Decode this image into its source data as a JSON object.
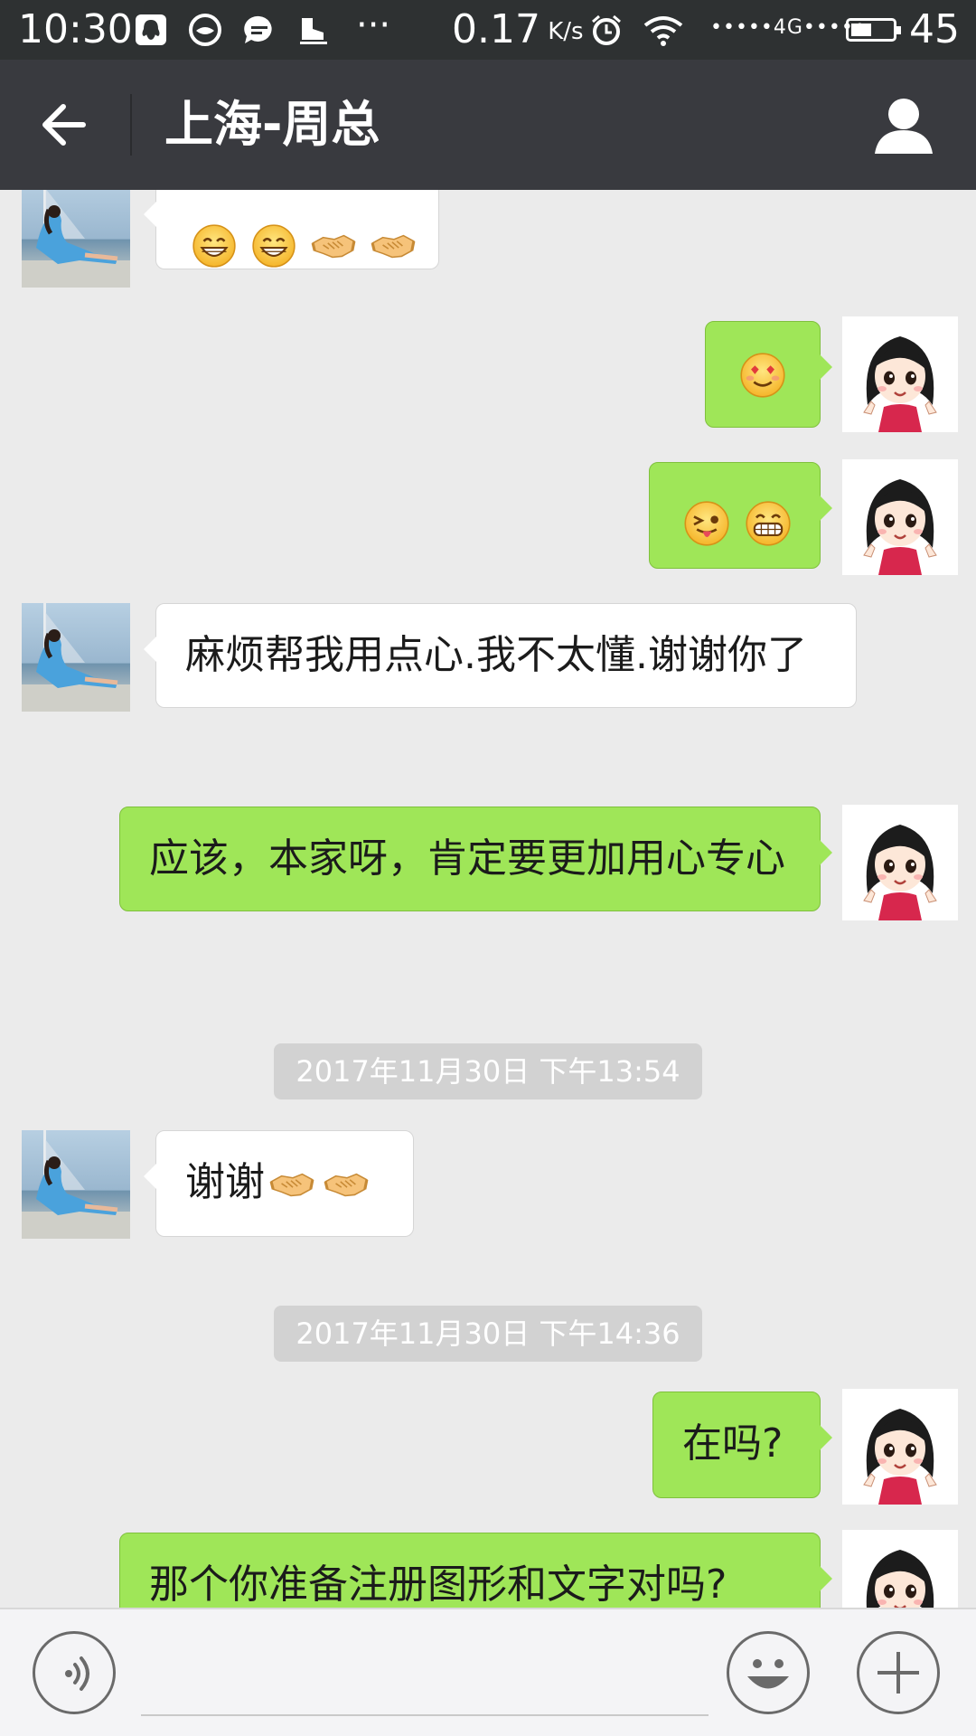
{
  "status_bar": {
    "time": "10:30",
    "speed_value": "0.17",
    "speed_unit": "K/s",
    "network": "•••••4G•••••",
    "battery_level": "45"
  },
  "header": {
    "title": "上海-周总",
    "back_icon": "back-arrow-icon",
    "profile_icon": "person-icon"
  },
  "messages": [
    {
      "side": "in",
      "text": "",
      "emojis": [
        "grin",
        "grin",
        "handshake",
        "handshake"
      ]
    },
    {
      "side": "out",
      "text": "",
      "emojis": [
        "heart-eyes"
      ]
    },
    {
      "side": "out",
      "text": "",
      "emojis": [
        "wink-tongue",
        "big-grin"
      ]
    },
    {
      "side": "in",
      "text": "麻烦帮我用点心.我不太懂.谢谢你了",
      "emojis": []
    },
    {
      "side": "out",
      "text": "应该，本家呀，肯定要更加用心专心",
      "emojis": []
    },
    {
      "side": "in",
      "text": "谢谢",
      "emojis": [
        "handshake",
        "handshake"
      ]
    },
    {
      "side": "out",
      "text": "在吗?",
      "emojis": []
    },
    {
      "side": "out",
      "text": "那个你准备注册图形和文字对吗?",
      "emojis": []
    }
  ],
  "timestamps": [
    "2017年11月30日 下午13:54",
    "2017年11月30日 下午14:36"
  ],
  "input_bar": {
    "voice_icon": "voice-icon",
    "emoji_icon": "smiley-icon",
    "more_icon": "plus-icon",
    "placeholder": ""
  },
  "colors": {
    "outgoing_bubble": "#9fe658",
    "incoming_bubble": "#ffffff",
    "header": "#393a3f",
    "status_bar": "#2e3132",
    "background": "#ebebeb"
  }
}
